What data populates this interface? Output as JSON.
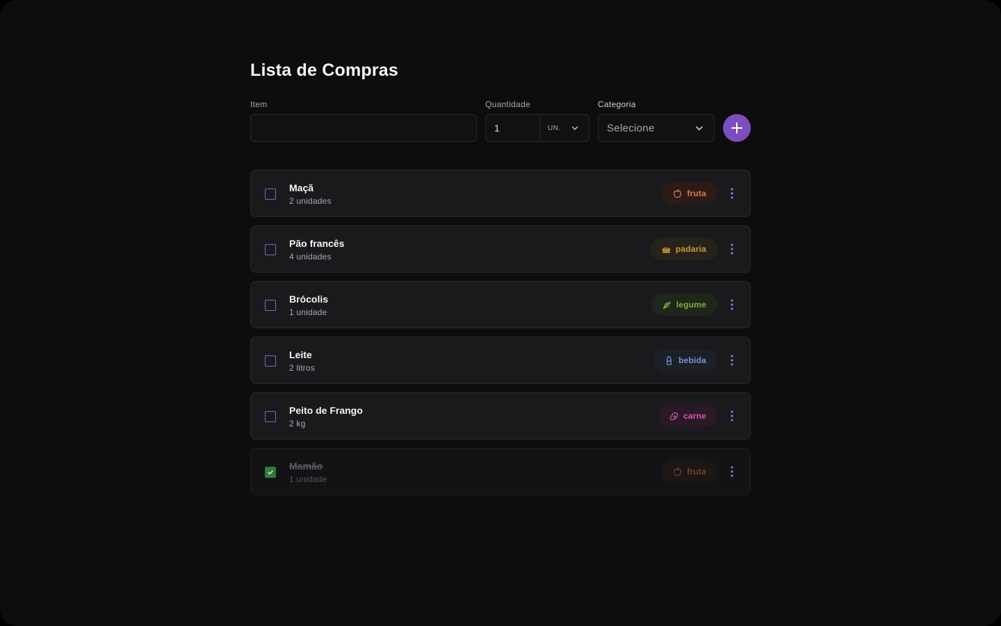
{
  "header": {
    "title": "Lista de Compras"
  },
  "form": {
    "item_label": "Item",
    "item_value": "",
    "item_placeholder": "",
    "quantity_label": "Quantidade",
    "quantity_value": "1",
    "unit_value": "UN.",
    "category_label": "Categoria",
    "category_value": "Selecione",
    "add_icon": "plus-icon",
    "accent_color": "#7c4dbd"
  },
  "items": [
    {
      "name": "Maçã",
      "quantity": "2 unidades",
      "checked": false,
      "category": "fruta",
      "icon": "apple-icon",
      "badge_bg": "#2c1b17",
      "badge_color": "#e07a4e"
    },
    {
      "name": "Pão francês",
      "quantity": "4 unidades",
      "checked": false,
      "category": "padaria",
      "icon": "sandwich-icon",
      "badge_bg": "#28231a",
      "badge_color": "#c99a3a"
    },
    {
      "name": "Brócolis",
      "quantity": "1 unidade",
      "checked": false,
      "category": "legume",
      "icon": "carrot-icon",
      "badge_bg": "#1f261c",
      "badge_color": "#7fae3f"
    },
    {
      "name": "Leite",
      "quantity": "2 litros",
      "checked": false,
      "category": "bebida",
      "icon": "milk-icon",
      "badge_bg": "#1b2029",
      "badge_color": "#7b93d6"
    },
    {
      "name": "Peito de Frango",
      "quantity": "2 kg",
      "checked": false,
      "category": "carne",
      "icon": "beef-icon",
      "badge_bg": "#2a1a26",
      "badge_color": "#d957b8"
    },
    {
      "name": "Mamão",
      "quantity": "1 unidade",
      "checked": true,
      "category": "fruta",
      "icon": "apple-icon",
      "badge_bg": "#2c1b17",
      "badge_color": "#e07a4e"
    }
  ],
  "checked_color": "#2f7a3d",
  "menu_icon": "more-vertical-icon"
}
